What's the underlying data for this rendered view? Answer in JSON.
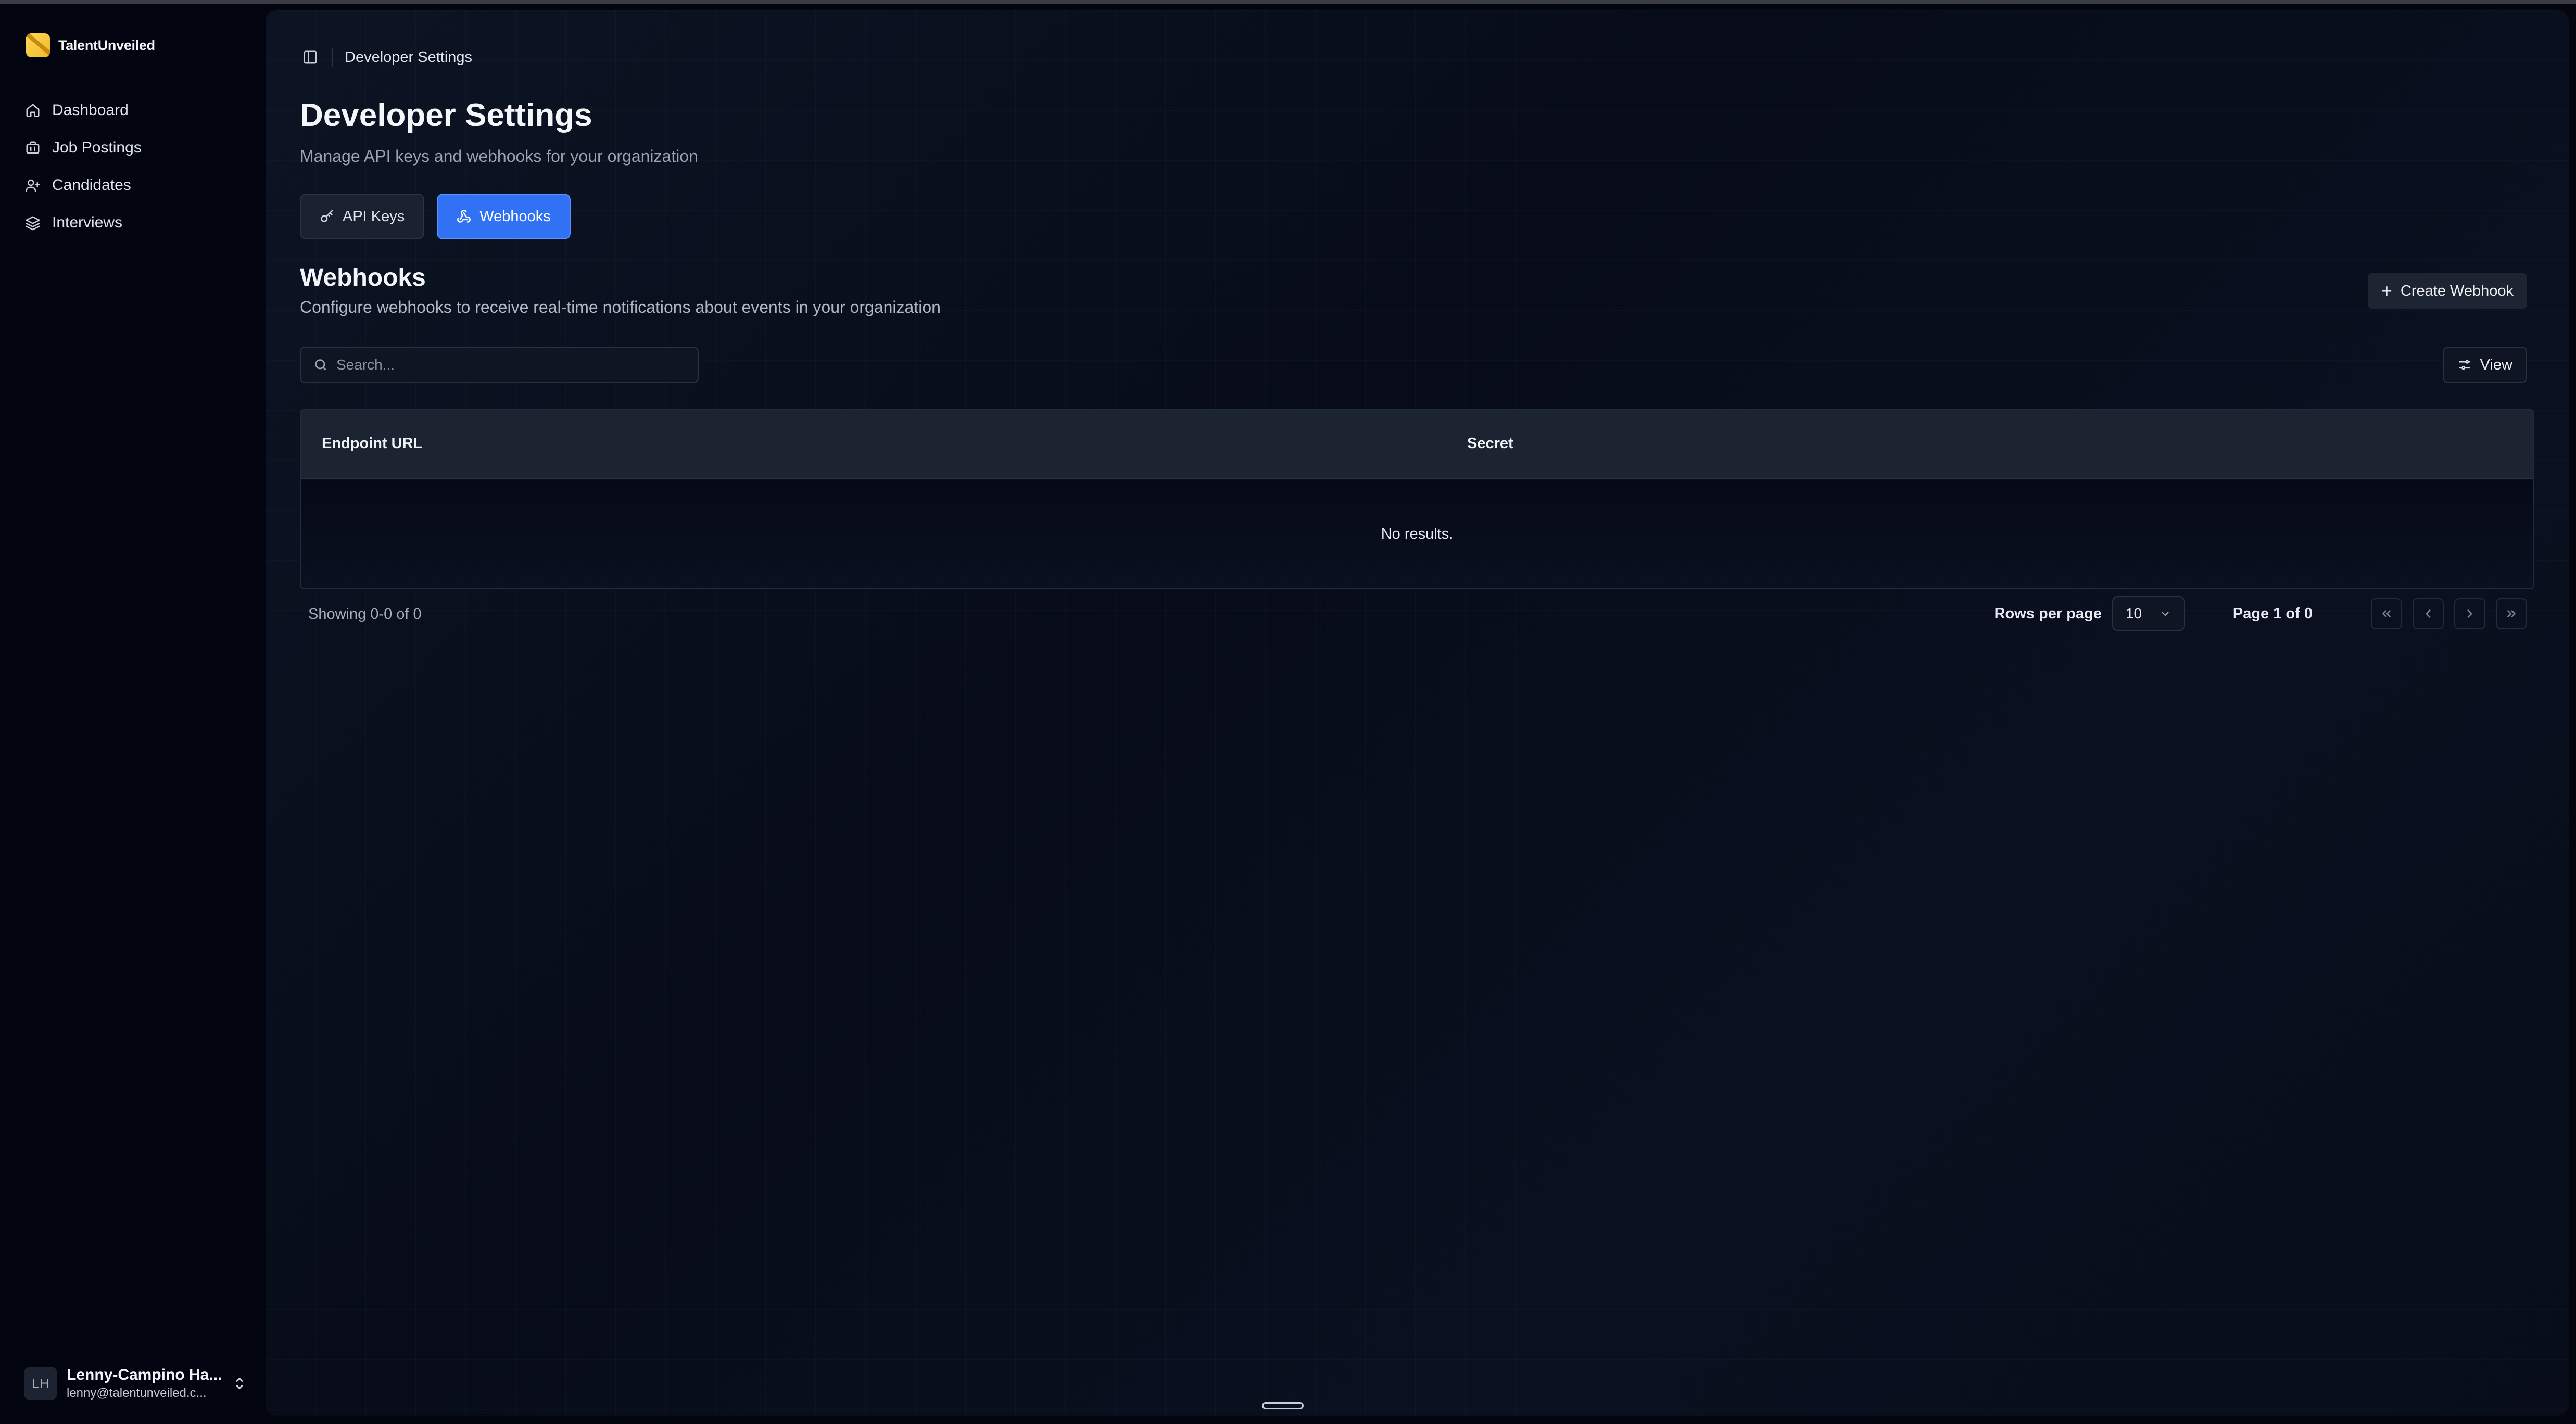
{
  "app": {
    "name": "TalentUnveiled"
  },
  "sidebar": {
    "items": [
      {
        "label": "Dashboard",
        "icon": "home-icon"
      },
      {
        "label": "Job Postings",
        "icon": "briefcase-icon"
      },
      {
        "label": "Candidates",
        "icon": "user-plus-icon"
      },
      {
        "label": "Interviews",
        "icon": "layers-icon"
      }
    ],
    "user": {
      "initials": "LH",
      "name": "Lenny-Campino Ha...",
      "email": "lenny@talentunveiled.c..."
    }
  },
  "header": {
    "breadcrumb": "Developer Settings"
  },
  "page": {
    "title": "Developer Settings",
    "subtitle": "Manage API keys and webhooks for your organization"
  },
  "tabs": [
    {
      "label": "API Keys",
      "icon": "key-icon",
      "active": false
    },
    {
      "label": "Webhooks",
      "icon": "webhook-icon",
      "active": true
    }
  ],
  "section": {
    "title": "Webhooks",
    "subtitle": "Configure webhooks to receive real-time notifications about events in your organization",
    "create_label": "Create Webhook"
  },
  "toolbar": {
    "search_placeholder": "Search...",
    "view_label": "View"
  },
  "table": {
    "columns": [
      "Endpoint URL",
      "Secret"
    ],
    "empty_text": "No results."
  },
  "pagination": {
    "showing": "Showing 0-0 of 0",
    "rows_label": "Rows per page",
    "rows_value": "10",
    "page_info": "Page 1 of 0"
  },
  "colors": {
    "accent": "#3172f4",
    "background": "#03060f",
    "panel": "#0b1222"
  }
}
